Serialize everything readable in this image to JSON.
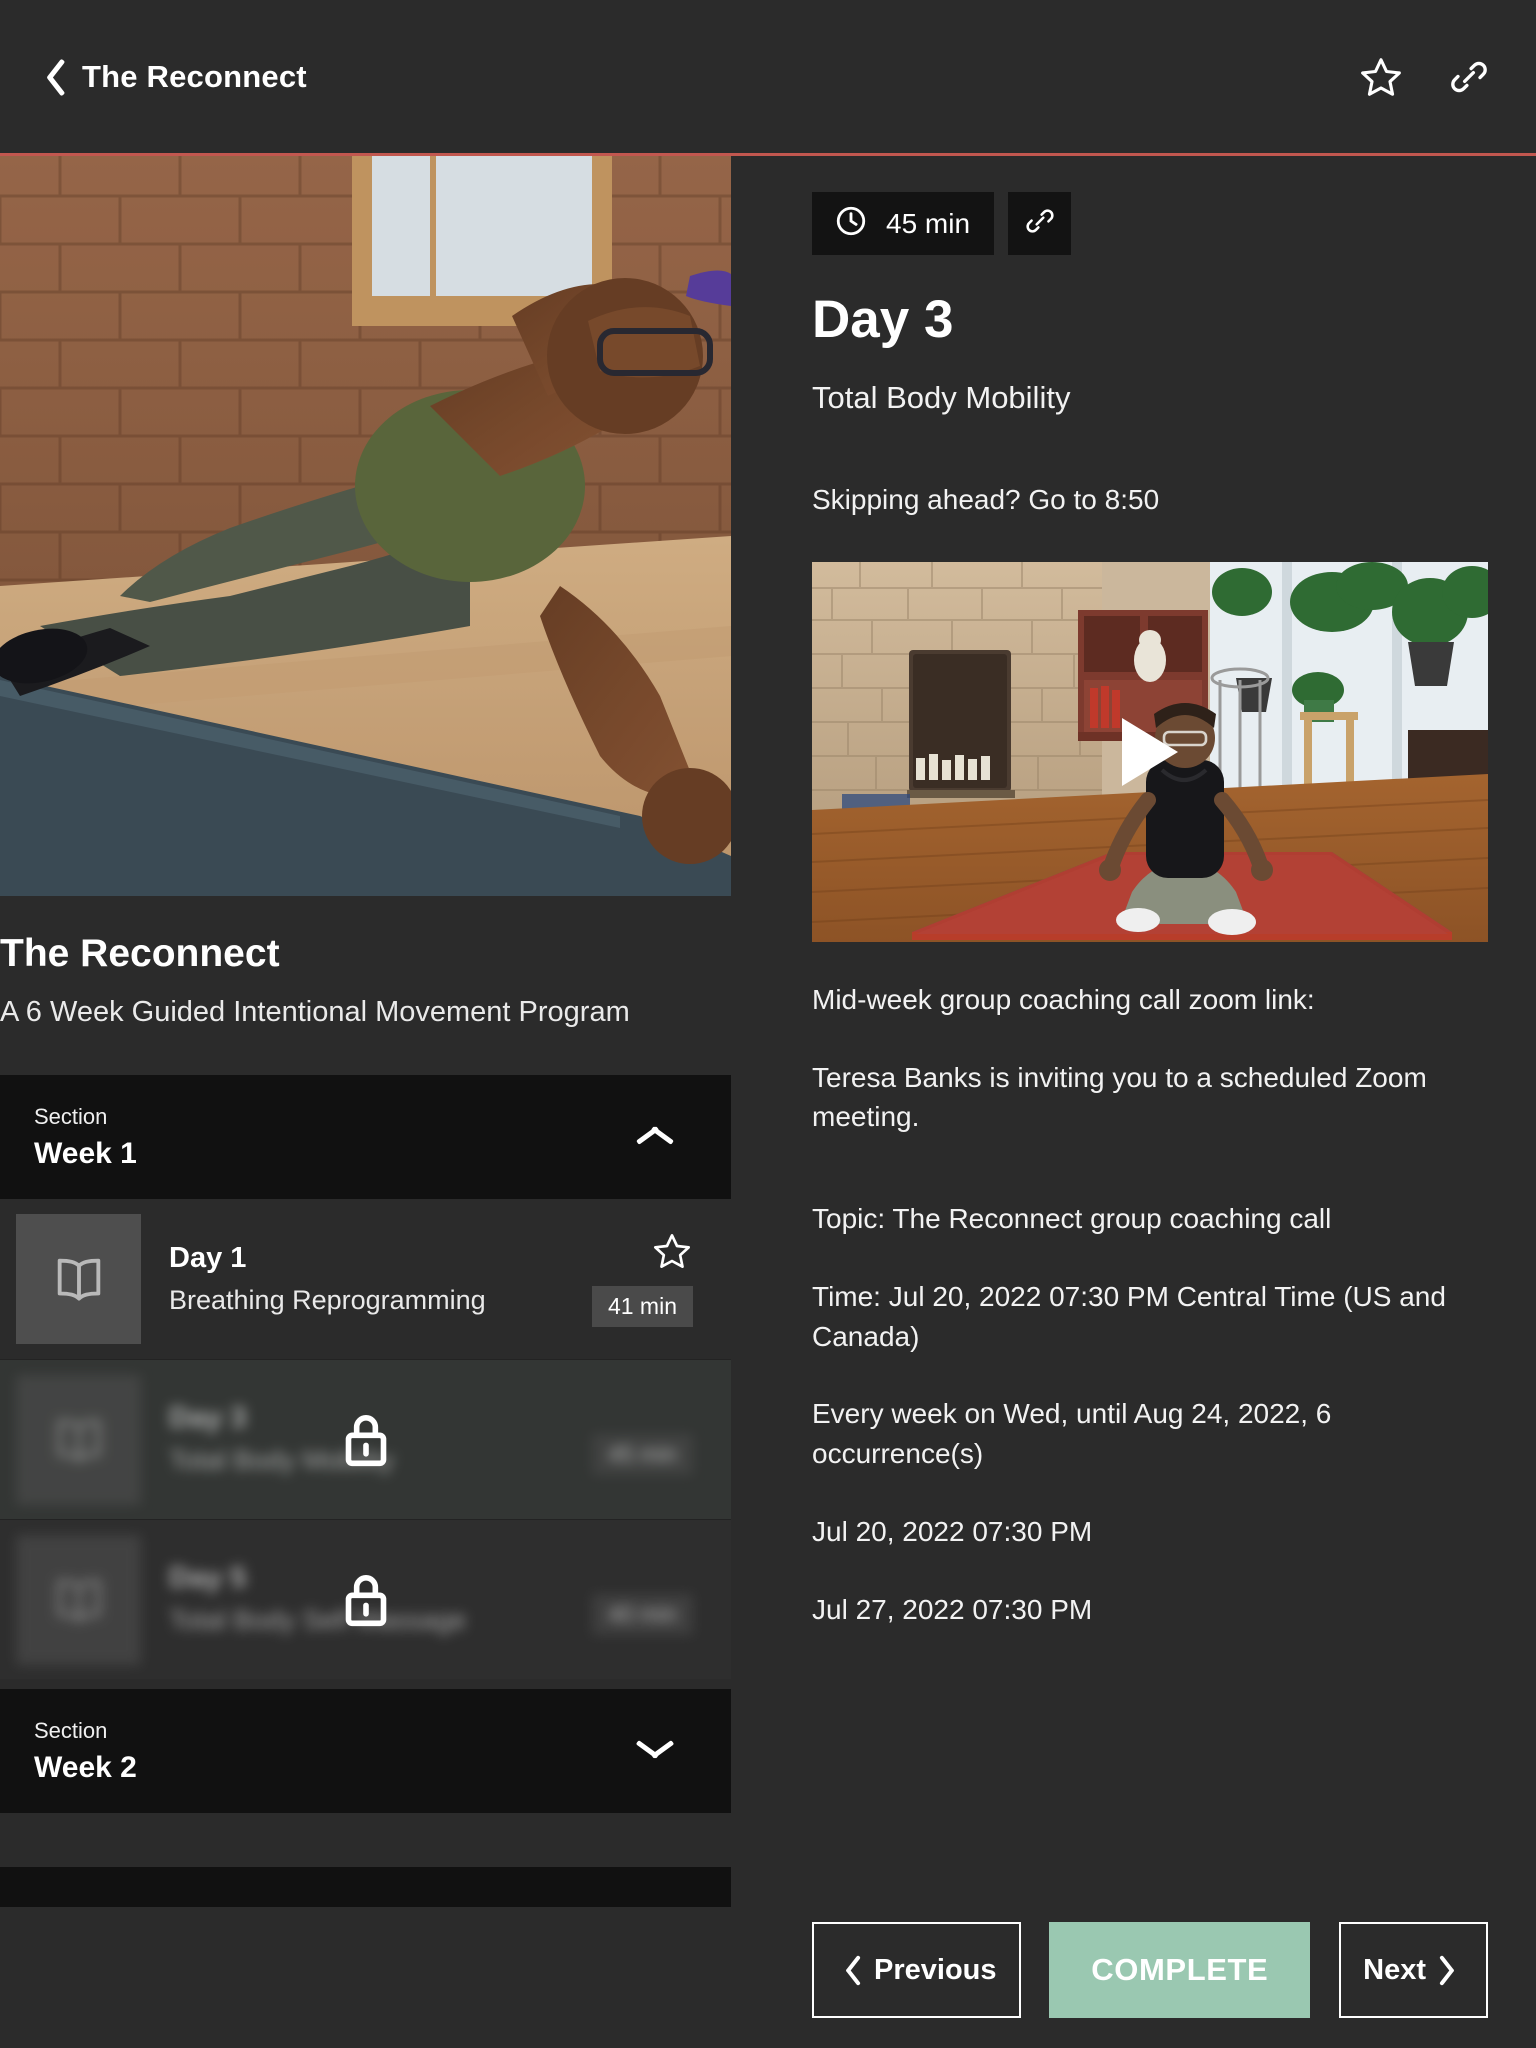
{
  "header": {
    "title": "The Reconnect",
    "back_icon": "chevron-left-icon",
    "favorite_icon": "star-outline-icon",
    "share_icon": "link-icon",
    "accent_color": "#c2574f"
  },
  "course": {
    "title": "The Reconnect",
    "subtitle": "A 6 Week Guided Intentional Movement Program",
    "hero_alt": "woman in side plank on blue yoga mat in brick studio"
  },
  "curriculum": {
    "section_label": "Section",
    "sections": [
      {
        "label": "Section",
        "name": "Week 1",
        "expanded": true,
        "toggle_icon": "chevron-up-icon",
        "lessons": [
          {
            "day": "Day 1",
            "description": "Breathing  Reprogramming",
            "duration": "41 min",
            "locked": false,
            "favorited": false,
            "icon": "book-icon",
            "favorite_icon": "star-outline-icon"
          },
          {
            "day": "Day 3",
            "description": "Total Body Mobility",
            "duration": "45 min",
            "locked": true,
            "icon": "book-icon",
            "lock_icon": "lock-icon"
          },
          {
            "day": "Day 5",
            "description": "Total Body Self Massage",
            "duration": "40 min",
            "locked": true,
            "icon": "book-icon",
            "lock_icon": "lock-icon"
          }
        ]
      },
      {
        "label": "Section",
        "name": "Week 2",
        "expanded": false,
        "toggle_icon": "chevron-down-icon",
        "lessons": []
      }
    ]
  },
  "lesson": {
    "duration": "45 min",
    "duration_icon": "clock-icon",
    "share_icon": "link-icon",
    "title": "Day 3",
    "subtitle": "Total Body Mobility",
    "skip_note": "Skipping ahead? Go to 8:50",
    "video": {
      "play_icon": "play-icon",
      "alt": "instructor seated cross-legged on mat in living room with brick fireplace"
    },
    "zoom_intro": "Mid-week group coaching call zoom link:",
    "zoom_invite": "Teresa Banks is inviting you to a scheduled Zoom meeting.",
    "zoom_topic": "Topic: The Reconnect group coaching call",
    "zoom_time": "Time: Jul 20, 2022 07:30 PM Central Time (US and Canada)",
    "zoom_recurrence": "Every week on Wed, until Aug 24, 2022, 6 occurrence(s)",
    "zoom_date_1": "Jul 20, 2022 07:30 PM",
    "zoom_date_2": "Jul 27, 2022 07:30 PM"
  },
  "footer": {
    "previous_label": "Previous",
    "previous_icon": "chevron-left-icon",
    "complete_label": "COMPLETE",
    "complete_color": "#9ac8b1",
    "next_label": "Next",
    "next_icon": "chevron-right-icon"
  }
}
